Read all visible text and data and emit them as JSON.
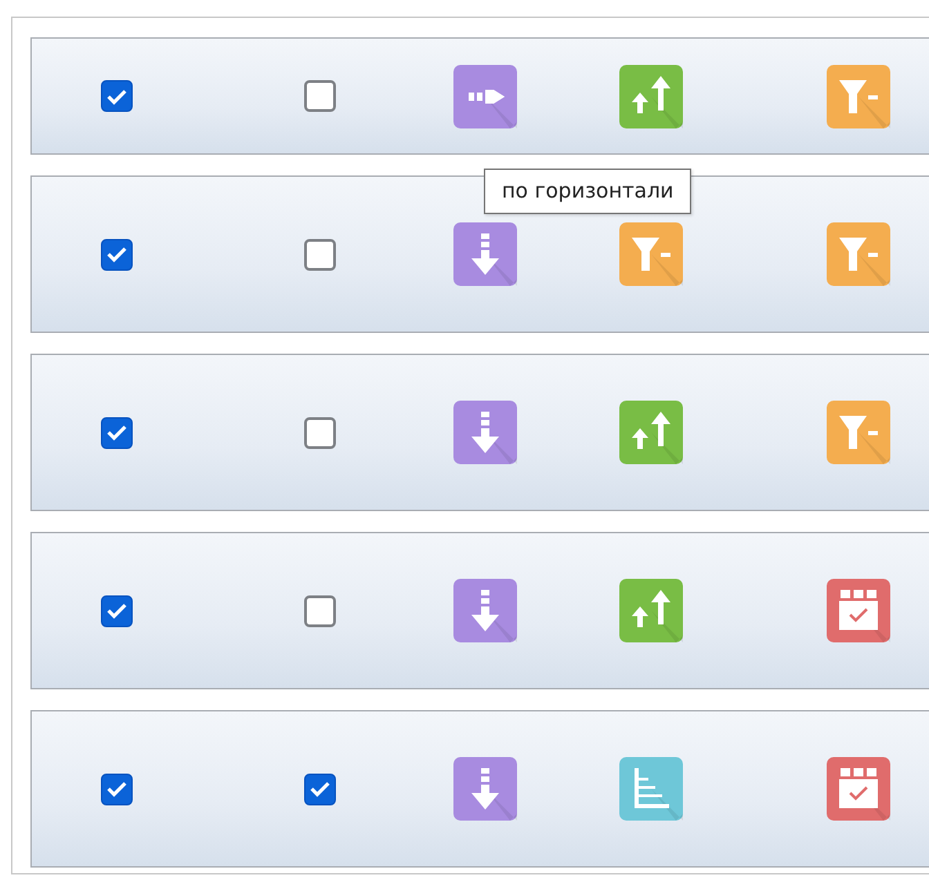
{
  "rows": [
    {
      "check_a": {
        "checked": true
      },
      "check_b": {
        "checked": false
      },
      "icons": [
        {
          "kind": "arrow-right"
        },
        {
          "kind": "sort-up"
        },
        {
          "kind": "filter"
        }
      ]
    },
    {
      "check_a": {
        "checked": true
      },
      "check_b": {
        "checked": false
      },
      "icons": [
        {
          "kind": "arrow-down"
        },
        {
          "kind": "filter"
        },
        {
          "kind": "filter"
        }
      ]
    },
    {
      "check_a": {
        "checked": true
      },
      "check_b": {
        "checked": false
      },
      "icons": [
        {
          "kind": "arrow-down"
        },
        {
          "kind": "sort-up"
        },
        {
          "kind": "filter"
        }
      ]
    },
    {
      "check_a": {
        "checked": true
      },
      "check_b": {
        "checked": false
      },
      "icons": [
        {
          "kind": "arrow-down"
        },
        {
          "kind": "sort-up"
        },
        {
          "kind": "calendar"
        }
      ]
    },
    {
      "check_a": {
        "checked": true
      },
      "check_b": {
        "checked": true
      },
      "icons": [
        {
          "kind": "arrow-down"
        },
        {
          "kind": "bar-list"
        },
        {
          "kind": "calendar"
        }
      ]
    }
  ],
  "tooltip": {
    "text": "по горизонтали"
  }
}
